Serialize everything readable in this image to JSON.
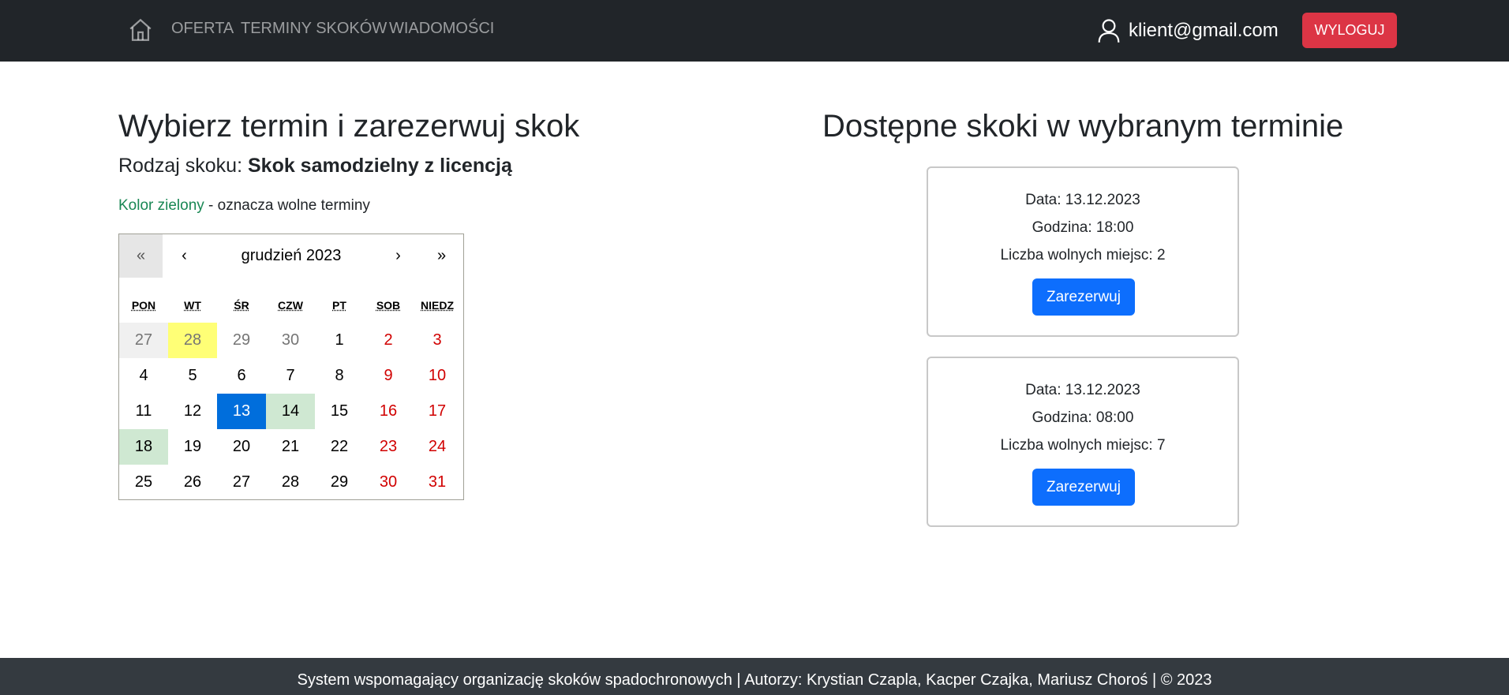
{
  "nav": {
    "home_icon": "home-icon",
    "links": [
      "OFERTA",
      "TERMINY SKOKÓW",
      "WIADOMOŚCI"
    ],
    "user_icon": "user-icon",
    "user_email": "klient@gmail.com",
    "logout_label": "WYLOGUJ"
  },
  "left": {
    "title": "Wybierz termin i zarezerwuj skok",
    "jump_type_prefix": "Rodzaj skoku:",
    "jump_type_value": "Skok samodzielny z licencją",
    "legend_colored": "Kolor zielony",
    "legend_rest": " - oznacza wolne terminy"
  },
  "calendar": {
    "prev2": "«",
    "prev": "‹",
    "label": "grudzień 2023",
    "next": "›",
    "next2": "»",
    "weekdays": [
      "PON",
      "WT",
      "ŚR",
      "CZW",
      "PT",
      "SOB",
      "NIEDZ"
    ],
    "weeks": [
      [
        "27",
        "28",
        "29",
        "30",
        "1",
        "2",
        "3"
      ],
      [
        "4",
        "5",
        "6",
        "7",
        "8",
        "9",
        "10"
      ],
      [
        "11",
        "12",
        "13",
        "14",
        "15",
        "16",
        "17"
      ],
      [
        "18",
        "19",
        "20",
        "21",
        "22",
        "23",
        "24"
      ],
      [
        "25",
        "26",
        "27",
        "28",
        "29",
        "30",
        "31"
      ]
    ]
  },
  "right": {
    "title": "Dostępne skoki w wybranym terminie",
    "slots": [
      {
        "date": "Data: 13.12.2023",
        "time": "Godzina: 18:00",
        "free": "Liczba wolnych miejsc: 2",
        "button": "Zarezerwuj"
      },
      {
        "date": "Data: 13.12.2023",
        "time": "Godzina: 08:00",
        "free": "Liczba wolnych miejsc: 7",
        "button": "Zarezerwuj"
      }
    ]
  },
  "footer": {
    "text": "System wspomagający organizację skoków spadochronowych | Autorzy: Krystian Czapla, Kacper Czajka, Mariusz Choroś | © 2023"
  },
  "colors": {
    "navbar": "#212529",
    "logout": "#dc3545",
    "reserve": "#0d6efd",
    "selected_day": "#006edc",
    "available_day": "#cfe8d2",
    "today_day": "#ffff76",
    "weekend_text": "#d10000",
    "legend_green": "#198754"
  }
}
